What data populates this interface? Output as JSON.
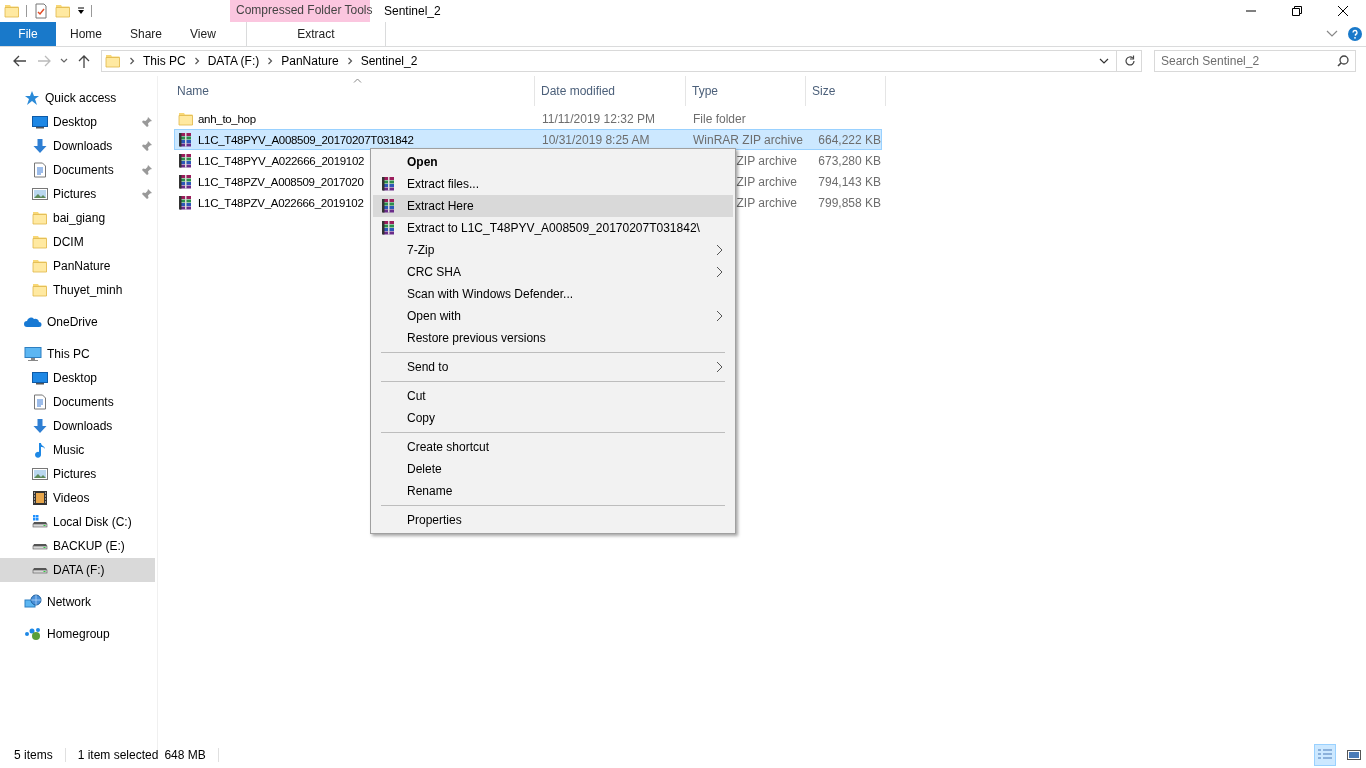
{
  "window": {
    "title": "Sentinel_2",
    "contextual_group": "Compressed Folder Tools"
  },
  "ribbon_tabs": [
    {
      "label": "File",
      "kind": "file",
      "selected": false
    },
    {
      "label": "Home",
      "kind": "tab",
      "selected": false
    },
    {
      "label": "Share",
      "kind": "tab",
      "selected": false
    },
    {
      "label": "View",
      "kind": "tab",
      "selected": false
    },
    {
      "label": "Extract",
      "kind": "contextual",
      "selected": false
    }
  ],
  "address": {
    "path": [
      "This PC",
      "DATA (F:)",
      "PanNature",
      "Sentinel_2"
    ]
  },
  "search": {
    "placeholder": "Search Sentinel_2"
  },
  "sidebar": {
    "items": [
      {
        "label": "Quick access",
        "kind": "star",
        "selected": false,
        "children": [
          {
            "label": "Desktop",
            "kind": "desktop",
            "pinned": true,
            "selected": false
          },
          {
            "label": "Downloads",
            "kind": "download",
            "pinned": true,
            "selected": false
          },
          {
            "label": "Documents",
            "kind": "document",
            "pinned": true,
            "selected": false
          },
          {
            "label": "Pictures",
            "kind": "pictures",
            "pinned": true,
            "selected": false
          },
          {
            "label": "bai_giang",
            "kind": "folder",
            "pinned": false,
            "selected": false
          },
          {
            "label": "DCIM",
            "kind": "folder",
            "pinned": false,
            "selected": false
          },
          {
            "label": "PanNature",
            "kind": "folder",
            "pinned": false,
            "selected": false
          },
          {
            "label": "Thuyet_minh",
            "kind": "folder",
            "pinned": false,
            "selected": false
          }
        ]
      },
      {
        "label": "OneDrive",
        "kind": "cloud",
        "selected": false
      },
      {
        "label": "This PC",
        "kind": "computer",
        "selected": false,
        "children": [
          {
            "label": "Desktop",
            "kind": "desktop",
            "pinned": false,
            "selected": false
          },
          {
            "label": "Documents",
            "kind": "document",
            "pinned": false,
            "selected": false
          },
          {
            "label": "Downloads",
            "kind": "download",
            "pinned": false,
            "selected": false
          },
          {
            "label": "Music",
            "kind": "music",
            "pinned": false,
            "selected": false
          },
          {
            "label": "Pictures",
            "kind": "pictures",
            "pinned": false,
            "selected": false
          },
          {
            "label": "Videos",
            "kind": "video",
            "pinned": false,
            "selected": false
          },
          {
            "label": "Local Disk (C:)",
            "kind": "system-drive",
            "pinned": false,
            "selected": false
          },
          {
            "label": "BACKUP (E:)",
            "kind": "drive",
            "pinned": false,
            "selected": false
          },
          {
            "label": "DATA (F:)",
            "kind": "drive",
            "pinned": false,
            "selected": true
          }
        ]
      },
      {
        "label": "Network",
        "kind": "network",
        "selected": false
      },
      {
        "label": "Homegroup",
        "kind": "homegroup",
        "selected": false
      }
    ]
  },
  "table": {
    "columns": [
      {
        "label": "Name",
        "sorted": true
      },
      {
        "label": "Date modified",
        "sorted": false
      },
      {
        "label": "Type",
        "sorted": false
      },
      {
        "label": "Size",
        "sorted": false
      }
    ],
    "rows": [
      {
        "kind": "folder",
        "name": "anh_to_hop",
        "date": "11/11/2019 12:32 PM",
        "type": "File folder",
        "selected": false
      },
      {
        "kind": "archive",
        "name": "L1C_T48PYV_A008509_20170207T031842",
        "date": "10/31/2019 8:25 AM",
        "type": "WinRAR ZIP archive",
        "size": "664,222 KB",
        "selected": true
      },
      {
        "kind": "archive",
        "name": "L1C_T48PYV_A022666_2019102",
        "type": "ZIP archive",
        "size": "673,280 KB",
        "selected": false
      },
      {
        "kind": "archive",
        "name": "L1C_T48PZV_A008509_2017020",
        "type": "ZIP archive",
        "size": "794,143 KB",
        "selected": false
      },
      {
        "kind": "archive",
        "name": "L1C_T48PZV_A022666_2019102",
        "type": "ZIP archive",
        "size": "799,858 KB",
        "selected": false
      }
    ]
  },
  "context_menu": {
    "items": [
      {
        "kind": "item",
        "label": "Open",
        "default": true,
        "icon": false,
        "submenu": false,
        "selected": false
      },
      {
        "kind": "item",
        "label": "Extract files...",
        "default": false,
        "icon": true,
        "submenu": false,
        "selected": false
      },
      {
        "kind": "item",
        "label": "Extract Here",
        "default": false,
        "icon": true,
        "submenu": false,
        "selected": true
      },
      {
        "kind": "item",
        "label": "Extract to L1C_T48PYV_A008509_20170207T031842\\",
        "default": false,
        "icon": true,
        "submenu": false,
        "selected": false
      },
      {
        "kind": "item",
        "label": "7-Zip",
        "default": false,
        "icon": false,
        "submenu": true,
        "selected": false
      },
      {
        "kind": "item",
        "label": "CRC SHA",
        "default": false,
        "icon": false,
        "submenu": true,
        "selected": false
      },
      {
        "kind": "item",
        "label": "Scan with Windows Defender...",
        "default": false,
        "icon": false,
        "submenu": false,
        "selected": false
      },
      {
        "kind": "item",
        "label": "Open with",
        "default": false,
        "icon": false,
        "submenu": true,
        "selected": false
      },
      {
        "kind": "item",
        "label": "Restore previous versions",
        "default": false,
        "icon": false,
        "submenu": false,
        "selected": false
      },
      {
        "kind": "separator"
      },
      {
        "kind": "item",
        "label": "Send to",
        "default": false,
        "icon": false,
        "submenu": true,
        "selected": false
      },
      {
        "kind": "separator"
      },
      {
        "kind": "item",
        "label": "Cut",
        "default": false,
        "icon": false,
        "submenu": false,
        "selected": false
      },
      {
        "kind": "item",
        "label": "Copy",
        "default": false,
        "icon": false,
        "submenu": false,
        "selected": false
      },
      {
        "kind": "separator"
      },
      {
        "kind": "item",
        "label": "Create shortcut",
        "default": false,
        "icon": false,
        "submenu": false,
        "selected": false
      },
      {
        "kind": "item",
        "label": "Delete",
        "default": false,
        "icon": false,
        "submenu": false,
        "selected": false
      },
      {
        "kind": "item",
        "label": "Rename",
        "default": false,
        "icon": false,
        "submenu": false,
        "selected": false
      },
      {
        "kind": "separator"
      },
      {
        "kind": "item",
        "label": "Properties",
        "default": false,
        "icon": false,
        "submenu": false,
        "selected": false
      }
    ]
  },
  "status_bar": {
    "item_count": "5 items",
    "selection": "1 item selected",
    "selection_size": "648 MB",
    "views": [
      {
        "kind": "details",
        "selected": true
      },
      {
        "kind": "large-icons",
        "selected": false
      }
    ]
  }
}
